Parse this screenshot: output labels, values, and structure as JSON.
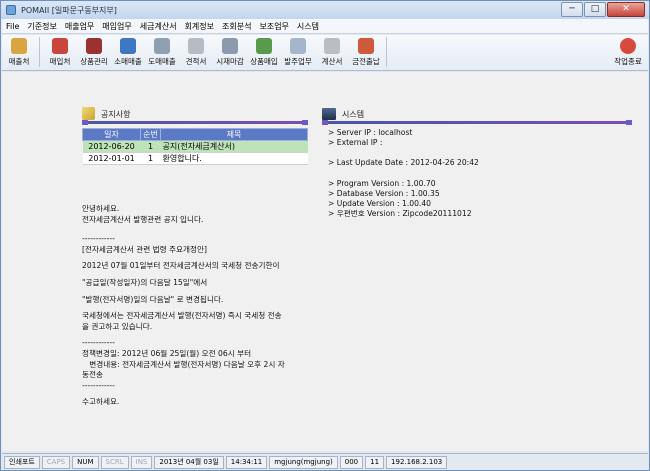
{
  "window": {
    "title": "POMAII [일파문구동부지부]",
    "min_glyph": "─",
    "max_glyph": "□",
    "close_glyph": "✕"
  },
  "menu": [
    "File",
    "기준정보",
    "매출업무",
    "매입업무",
    "세금계산서",
    "회계정보",
    "조회분석",
    "보조업무",
    "시스템"
  ],
  "toolbar": [
    {
      "label": "매출처",
      "color": "#d9a441"
    },
    {
      "label": "매입처",
      "color": "#c9463d"
    },
    {
      "label": "상품관리",
      "color": "#9b3232"
    },
    {
      "label": "소매매출",
      "color": "#3e78c2"
    },
    {
      "label": "도매매출",
      "color": "#8fa0b3"
    },
    {
      "label": "견적서",
      "color": "#b6bcc4"
    },
    {
      "label": "시재마감",
      "color": "#8c9aad"
    },
    {
      "label": "상품매입",
      "color": "#5a9a4e"
    },
    {
      "label": "발주업무",
      "color": "#a3b6cc"
    },
    {
      "label": "계산서",
      "color": "#b9bec5"
    },
    {
      "label": "금전출납",
      "color": "#cf5a3b"
    }
  ],
  "toolbar_right": {
    "label": "작업종료",
    "color": "#d8493e"
  },
  "notice": {
    "header": "공지사항",
    "columns": [
      "일자",
      "순번",
      "제목"
    ],
    "rows": [
      {
        "date": "2012-06-20",
        "no": "1",
        "title": "공지(전자세금계산서)"
      },
      {
        "date": "2012-01-01",
        "no": "1",
        "title": "환영합니다."
      }
    ],
    "body": [
      "안녕하세요.\n전자세금계산서 발행관련 공지 입니다.",
      "------------\n[전자세금계산서 관련 법령 주요개정안]",
      "2012년 07월 01일부터 전자세금계산서의 국세청 전송기한이",
      "\"공급일(작성일자)의 다음달 15일\"에서",
      "\"발행(전자서명)일의 다음날\" 로 변경됩니다.",
      "국세청에서는 전자세금계산서 발행(전자서명) 즉시 국세청 전송\n을 권고하고 있습니다.",
      "------------\n정책변경일: 2012년 06월 25일(월) 오전 06시 부터\n   변경내용: 전자세금계산서 발행(전자서명) 다음날 오후 2시 자\n동전송\n------------",
      "수고하세요."
    ]
  },
  "system": {
    "header": "시스템",
    "server": "> Server   IP : localhost",
    "external": "> External IP :",
    "last_update": "> Last Update Date : 2012-04-26 20:42",
    "program": "> Program  Version : 1.00.70",
    "database": "> Database Version : 1.00.35",
    "update": "> Update   Version : 1.00.40",
    "zipcode": "> 우편번호 Version : Zipcode20111012"
  },
  "status": [
    {
      "text": "인쇄포트",
      "dim": false
    },
    {
      "text": "CAPS",
      "dim": true
    },
    {
      "text": "NUM",
      "dim": false
    },
    {
      "text": "SCRL",
      "dim": true
    },
    {
      "text": "INS",
      "dim": true
    },
    {
      "text": "2013년 04월 03일",
      "dim": false
    },
    {
      "text": "14:34:11",
      "dim": false
    },
    {
      "text": "mgjung(mgjung)",
      "dim": false
    },
    {
      "text": "000",
      "dim": false
    },
    {
      "text": "11",
      "dim": false
    },
    {
      "text": "192.168.2.103",
      "dim": false
    }
  ]
}
